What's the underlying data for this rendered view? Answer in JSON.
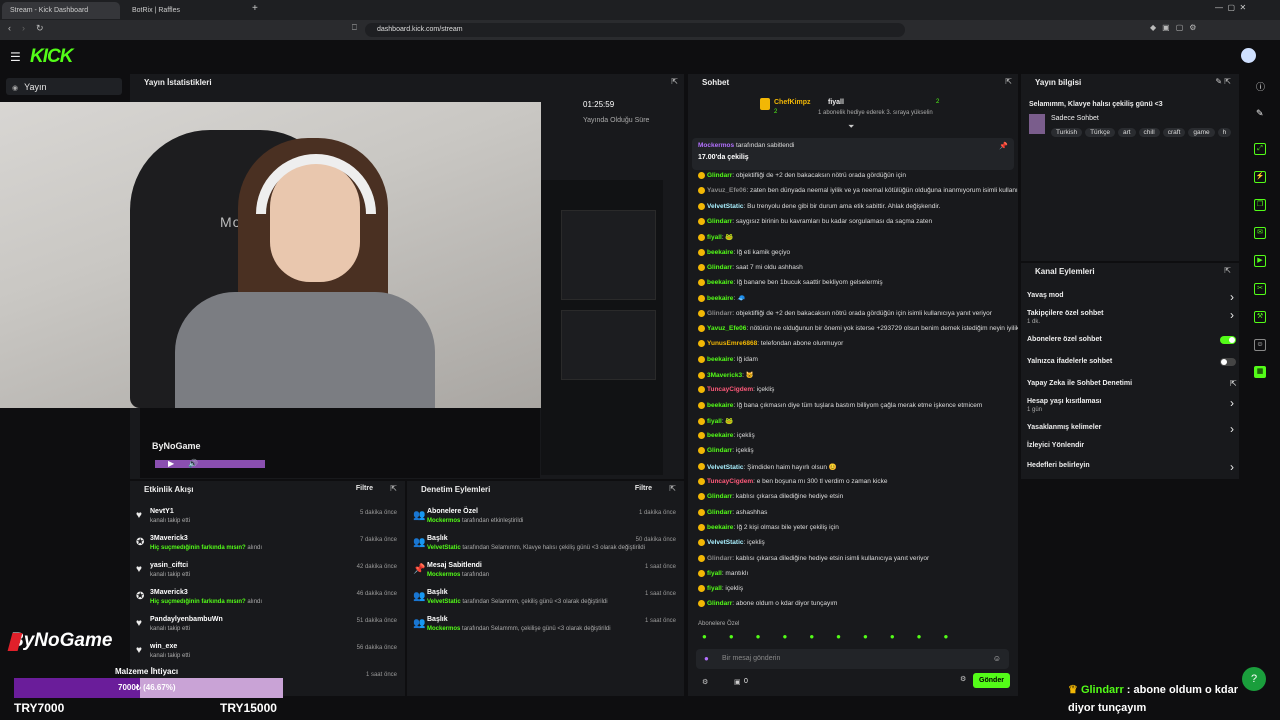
{
  "browser": {
    "tabs": [
      {
        "label": "Stream - Kick Dashboard"
      },
      {
        "label": "BotRix | Raffles"
      }
    ],
    "url": "dashboard.kick.com/stream"
  },
  "app": {
    "logo": "KICK",
    "nav_item": "Yayın"
  },
  "stats": {
    "title": "Yayın İstatistikleri",
    "duration": "01:25:59",
    "duration_label": "Yayında Olduğu Süre"
  },
  "activity": {
    "title": "Etkinlik Akışı",
    "filter_label": "Filtre",
    "rows": [
      {
        "name": "NevtY1",
        "sub": "kanalı takip etti",
        "highlight": "",
        "time": "5 dakika önce",
        "icon": "heart-icon"
      },
      {
        "name": "3Maverick3",
        "sub": "alındı",
        "highlight": "Hiç suçmedığinin farkında mısın?",
        "time": "7 dakika önce",
        "icon": "reward-icon"
      },
      {
        "name": "yasin_ciftci",
        "sub": "kanalı takip etti",
        "highlight": "",
        "time": "42 dakika önce",
        "icon": "heart-icon"
      },
      {
        "name": "3Maverick3",
        "sub": "alındı",
        "highlight": "Hiç suçmedığinin farkında mısın?",
        "time": "46 dakika önce",
        "icon": "reward-icon"
      },
      {
        "name": "PandaylyenbambuWn",
        "sub": "kanalı takip etti",
        "highlight": "",
        "time": "51 dakika önce",
        "icon": "heart-icon"
      },
      {
        "name": "win_exe",
        "sub": "kanalı takip etti",
        "highlight": "",
        "time": "56 dakika önce",
        "icon": "heart-icon"
      },
      {
        "name": "",
        "sub": "",
        "highlight": "",
        "time": "1 saat önce",
        "icon": ""
      }
    ]
  },
  "moderation": {
    "title": "Denetim Eylemleri",
    "filter_label": "Filtre",
    "rows": [
      {
        "name": "Abonelere Özel",
        "user": "Mockermos",
        "sub": "tarafından etkinleştirildi",
        "time": "1 dakika önce",
        "icon": "users-icon"
      },
      {
        "name": "Başlık",
        "user": "VelvetStatic",
        "sub": "tarafından Selamımm, Klavye halısı çekiliş günü <3 olarak değiştirildi",
        "time": "50 dakika önce",
        "icon": "users-icon"
      },
      {
        "name": "Mesaj Sabitlendi",
        "user": "Mockermos",
        "sub": "tarafından",
        "time": "1 saat önce",
        "icon": "pin-icon"
      },
      {
        "name": "Başlık",
        "user": "VelvetStatic",
        "sub": "tarafından Selammm, çekiliş günü <3 olarak değiştirildi",
        "time": "1 saat önce",
        "icon": "users-icon"
      },
      {
        "name": "Başlık",
        "user": "Mockermos",
        "sub": "tarafından Selammm, çekilişe günü <3 olarak değiştirildi",
        "time": "1 saat önce",
        "icon": "users-icon"
      }
    ]
  },
  "chat": {
    "title": "Sohbet",
    "leader1": {
      "name": "ChefKimpz",
      "count": "2"
    },
    "leader2": {
      "name": "fiyall",
      "count": "2",
      "note": "1 abonelik hediye ederek 3. sıraya yükselin"
    },
    "pinned_by": "Mockermos",
    "pinned_text": "tarafından sabitlendi",
    "pinned_msg": "17.00'da çekiliş",
    "lines": [
      {
        "user": "Glindarr",
        "color": "#53fc18",
        "text": "objektifliği de +2 den bakacaksın nötrü orada gördüğün için"
      },
      {
        "user": "Yavuz_Efe06",
        "color": "#888888",
        "text": "zaten ben dünyada neemal iyilik ve ya neemal kötülüğün olduğuna inanmıyorum isimli kullanıcıya yanıt veriyor"
      },
      {
        "user": "VelvetStatic",
        "color": "#a9f0ff",
        "text": "Bu trenyolu dene gibi bir durum ama etik sabittir. Ahlak değişkendir."
      },
      {
        "user": "Glindarr",
        "color": "#53fc18",
        "text": "saygısız birinin bu kavramları bu kadar sorgulaması da saçma zaten"
      },
      {
        "user": "fiyall",
        "color": "#53fc18",
        "text": "🐸"
      },
      {
        "user": "beekaire",
        "color": "#53fc18",
        "text": "lğ eti kamik geçiyo"
      },
      {
        "user": "Glindarr",
        "color": "#53fc18",
        "text": "saat 7 mi oldu ashhash"
      },
      {
        "user": "beekaire",
        "color": "#53fc18",
        "text": "lğ banane ben 1bucuk saattir bekliyom gelselermiş"
      },
      {
        "user": "beekaire",
        "color": "#53fc18",
        "text": "🧢"
      },
      {
        "user": "Glindarr",
        "color": "#888888",
        "text": "objektifliği de +2 den bakacaksın nötrü orada gördüğün için isimli kullanıcıya yanıt veriyor"
      },
      {
        "user": "Yavuz_Efe06",
        "color": "#53fc18",
        "text": "nötürün ne olduğunun bir önemi yok isterse +293729 olsun benim demek istediğim neyin iyilik ve ya kötülük olabileceğine insanların karar vermesinin yanlış olması"
      },
      {
        "user": "YunusEmre6868",
        "color": "#f2b705",
        "text": "telefondan abone olunmuyor"
      },
      {
        "user": "beekaire",
        "color": "#53fc18",
        "text": "lğ idam"
      },
      {
        "user": "3Maverick3",
        "color": "#53fc18",
        "text": "🐱"
      },
      {
        "user": "TuncayCigdem",
        "color": "#ff5a7a",
        "text": "içekliş"
      },
      {
        "user": "beekaire",
        "color": "#53fc18",
        "text": "lğ bana çıkmasın diye tüm tuşlara bastım billiyom çağla merak etme işkence etmicem"
      },
      {
        "user": "fiyall",
        "color": "#53fc18",
        "text": "🐸"
      },
      {
        "user": "beekaire",
        "color": "#53fc18",
        "text": "içekliş"
      },
      {
        "user": "Glindarr",
        "color": "#53fc18",
        "text": "içekliş"
      },
      {
        "user": "VelvetStatic",
        "color": "#a9f0ff",
        "text": "Şimdiden haim hayırlı olsun 😊"
      },
      {
        "user": "TuncayCigdem",
        "color": "#ff5a7a",
        "text": "e ben boşuna mı 300 tl verdim o zaman kicke"
      },
      {
        "user": "Glindarr",
        "color": "#53fc18",
        "text": "kablısı çıkarsa dilediğine hediye etsin"
      },
      {
        "user": "Glindarr",
        "color": "#53fc18",
        "text": "ashashhas"
      },
      {
        "user": "beekaire",
        "color": "#53fc18",
        "text": "lğ 2 kişi olması bile yeter çekiliş için"
      },
      {
        "user": "VelvetStatic",
        "color": "#a9f0ff",
        "text": "içekliş"
      },
      {
        "user": "Glindarr",
        "color": "#888888",
        "text": "kablısı çıkarsa dilediğine hediye etsin isimli kullanıcıya yanıt veriyor"
      },
      {
        "user": "fiyall",
        "color": "#53fc18",
        "text": "mantıklı"
      },
      {
        "user": "fiyall",
        "color": "#53fc18",
        "text": "içekliş"
      },
      {
        "user": "Glindarr",
        "color": "#53fc18",
        "text": "abone oldum o kdar diyor tunçayım"
      }
    ],
    "mode_label": "Abonelere Özel",
    "input_placeholder": "Bir mesaj gönderin",
    "viewer_count": "0",
    "send_label": "Gönder"
  },
  "stream_info": {
    "title": "Yayın bilgisi",
    "stream_title": "Selamımm, Klavye halısı çekiliş günü <3",
    "category": "Sadece Sohbet",
    "tags": [
      "Turkish",
      "Türkçe",
      "art",
      "chill",
      "craft",
      "game",
      "h"
    ]
  },
  "channel_actions": {
    "title": "Kanal Eylemleri",
    "items": [
      {
        "label": "Yavaş mod",
        "sub": "",
        "control": "chevron"
      },
      {
        "label": "Takipçilere özel sohbet",
        "sub": "1 dk.",
        "control": "chevron"
      },
      {
        "label": "Abonelere özel sohbet",
        "sub": "",
        "control": "toggle-on"
      },
      {
        "label": "Yalnızca ifadelerle sohbet",
        "sub": "",
        "control": "toggle-off"
      },
      {
        "label": "Yapay Zeka ile Sohbet Denetimi",
        "sub": "",
        "control": "external"
      },
      {
        "label": "Hesap yaşı kısıtlaması",
        "sub": "1 gün",
        "control": "chevron"
      },
      {
        "label": "Yasaklanmış kelimeler",
        "sub": "",
        "control": "chevron"
      },
      {
        "label": "İzleyici Yönlendir",
        "sub": "",
        "control": ""
      },
      {
        "label": "Hedefleri belirleyin",
        "sub": "",
        "control": "chevron"
      }
    ]
  },
  "overlay": {
    "brand": "ByNoGame",
    "goal_label": "Malzeme İhtiyacı",
    "goal_amount": "7000₺ (46.67%)",
    "goal_progress": 0.4667,
    "goal_min": "TRY7000",
    "goal_max": "TRY15000",
    "ticker_user": "Glindarr",
    "ticker_text": ": abone oldum o kdar",
    "ticker_text2": "diyor tunçayım"
  },
  "colors": {
    "accent": "#53fc18",
    "background": "#0e0e10",
    "panel": "#18191c"
  }
}
